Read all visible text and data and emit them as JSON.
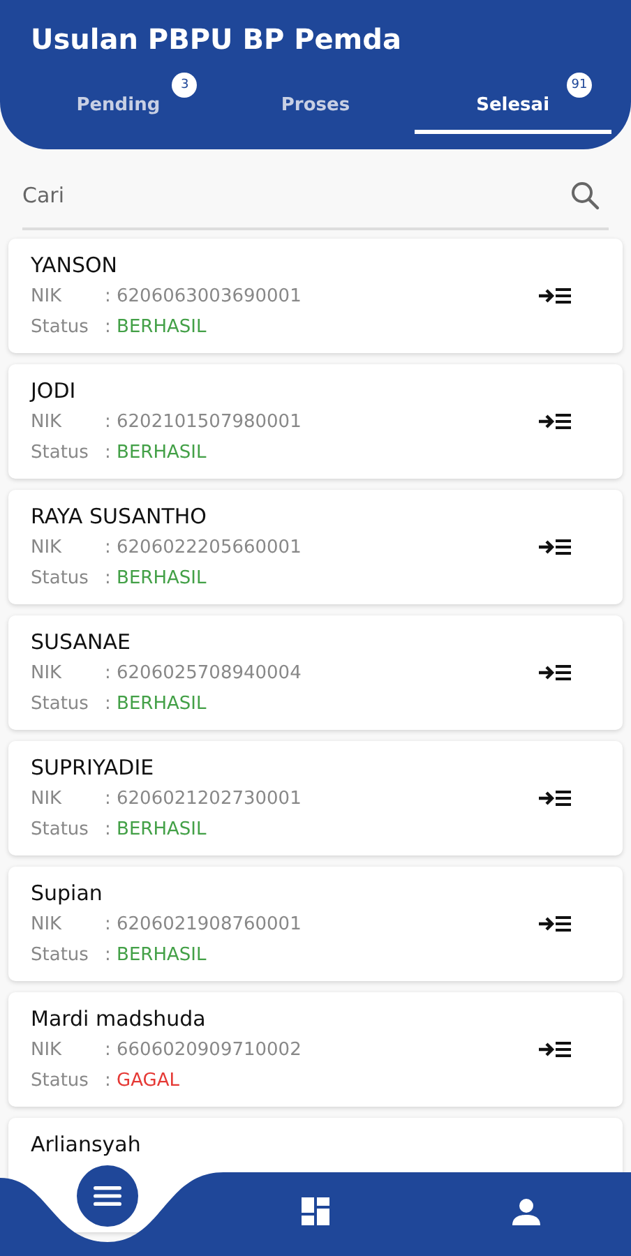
{
  "header": {
    "title": "Usulan PBPU BP Pemda"
  },
  "tabs": [
    {
      "label": "Pending",
      "badge": "3",
      "selected": false
    },
    {
      "label": "Proses",
      "selected": false
    },
    {
      "label": "Selesai",
      "badge": "91",
      "selected": true
    }
  ],
  "search": {
    "placeholder": "Cari"
  },
  "items": [
    {
      "name": "YANSON",
      "nik_label": "NIK",
      "nik": ": 6206063003690001",
      "status_label": "Status",
      "sep": ":",
      "status": "BERHASIL",
      "kind": "success"
    },
    {
      "name": "JODI",
      "nik_label": "NIK",
      "nik": ": 6202101507980001",
      "status_label": "Status",
      "sep": ":",
      "status": "BERHASIL",
      "kind": "success"
    },
    {
      "name": "RAYA SUSANTHO",
      "nik_label": "NIK",
      "nik": ": 6206022205660001",
      "status_label": "Status",
      "sep": ":",
      "status": "BERHASIL",
      "kind": "success"
    },
    {
      "name": "SUSANAE",
      "nik_label": "NIK",
      "nik": ": 6206025708940004",
      "status_label": "Status",
      "sep": ":",
      "status": "BERHASIL",
      "kind": "success"
    },
    {
      "name": "SUPRIYADIE",
      "nik_label": "NIK",
      "nik": ": 6206021202730001",
      "status_label": "Status",
      "sep": ":",
      "status": "BERHASIL",
      "kind": "success"
    },
    {
      "name": "Supian",
      "nik_label": "NIK",
      "nik": ": 6206021908760001",
      "status_label": "Status",
      "sep": ":",
      "status": "BERHASIL",
      "kind": "success"
    },
    {
      "name": "Mardi madshuda",
      "nik_label": "NIK",
      "nik": ": 6606020909710002",
      "status_label": "Status",
      "sep": ":",
      "status": "GAGAL",
      "kind": "failed"
    },
    {
      "name": "Arliansyah",
      "kind": "partial"
    }
  ],
  "bottom_nav": [
    {
      "kind": "menu"
    },
    {
      "kind": "dashboard"
    },
    {
      "kind": "profile"
    }
  ]
}
